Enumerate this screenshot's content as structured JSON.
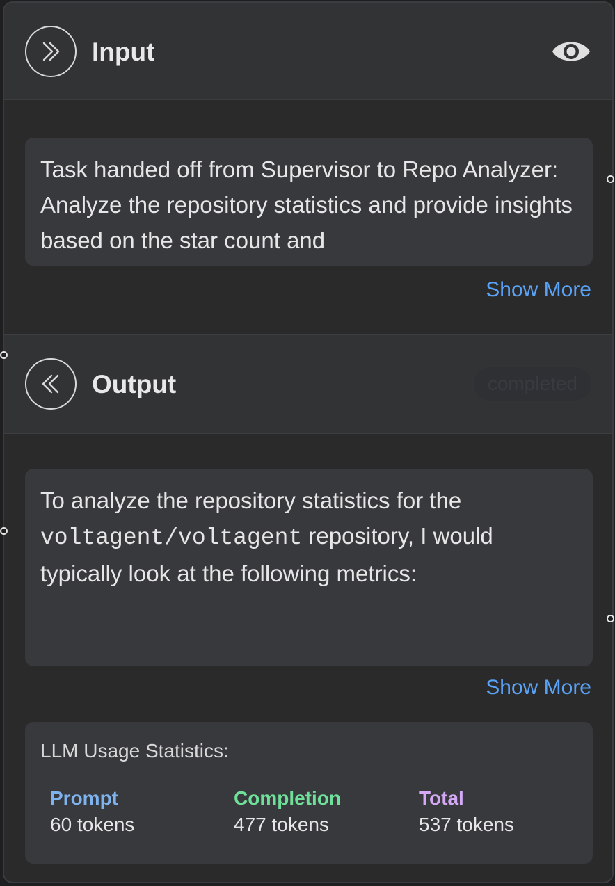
{
  "input_section": {
    "title": "Input",
    "text": "Task handed off from Supervisor to Repo Analyzer: Analyze the repository statistics and provide insights based on the star count and",
    "show_more": "Show More"
  },
  "output_section": {
    "title": "Output",
    "status": "completed",
    "text_before": "To analyze the repository statistics for the ",
    "code": "voltagent/voltagent",
    "text_after": " repository, I would typically look at the following metrics:",
    "show_more": "Show More"
  },
  "usage": {
    "title": "LLM Usage Statistics:",
    "prompt_label": "Prompt",
    "prompt_value": "60 tokens",
    "completion_label": "Completion",
    "completion_value": "477 tokens",
    "total_label": "Total",
    "total_value": "537 tokens"
  },
  "colors": {
    "prompt": "#7fb3ee",
    "completion": "#6fe09a",
    "total": "#d4a8f5",
    "link": "#5aa2f6"
  },
  "icons": {
    "input_icon": "chevrons-right-icon",
    "output_icon": "chevrons-left-icon",
    "view_icon": "eye-icon"
  }
}
